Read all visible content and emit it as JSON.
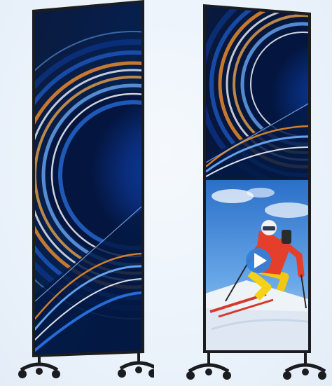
{
  "scene": {
    "description_visible_text": "",
    "colors": {
      "background": "#edf4fb",
      "frame": "#1b1c20",
      "screen_deep_blue": "#06204f",
      "accent_orange": "#e88a2a",
      "accent_white": "#f3f5f8",
      "sky_blue": "#3a7fd0",
      "snow": "#eef3f8",
      "play_button": "#2f82e0"
    }
  },
  "kiosks": [
    {
      "name": "left-kiosk",
      "content": "abstract-wallpaper"
    },
    {
      "name": "right-kiosk",
      "content": "split-wallpaper-and-video"
    }
  ],
  "icons": {
    "play": "play-icon",
    "caster": "caster-wheel-icon"
  }
}
